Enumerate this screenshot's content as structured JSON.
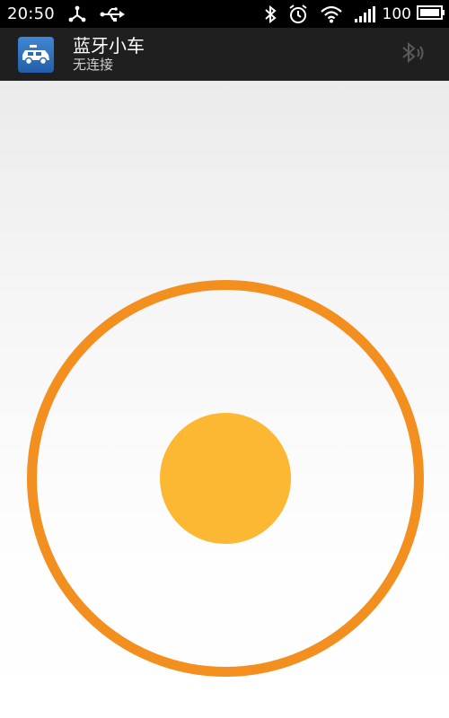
{
  "status_bar": {
    "time": "20:50",
    "battery_level": "100",
    "icons": [
      "network-hub-icon",
      "usb-icon",
      "bluetooth-icon",
      "alarm-icon",
      "wifi-icon",
      "signal-icon",
      "battery-icon"
    ]
  },
  "action_bar": {
    "app_icon": "car-icon",
    "title": "蓝牙小车",
    "subtitle": "无连接",
    "action_icon": "bluetooth-audio-icon"
  },
  "joystick": {
    "ring_color": "#f28f1e",
    "knob_color": "#fdb833",
    "knob_offset": {
      "x": 0,
      "y": 0
    }
  }
}
